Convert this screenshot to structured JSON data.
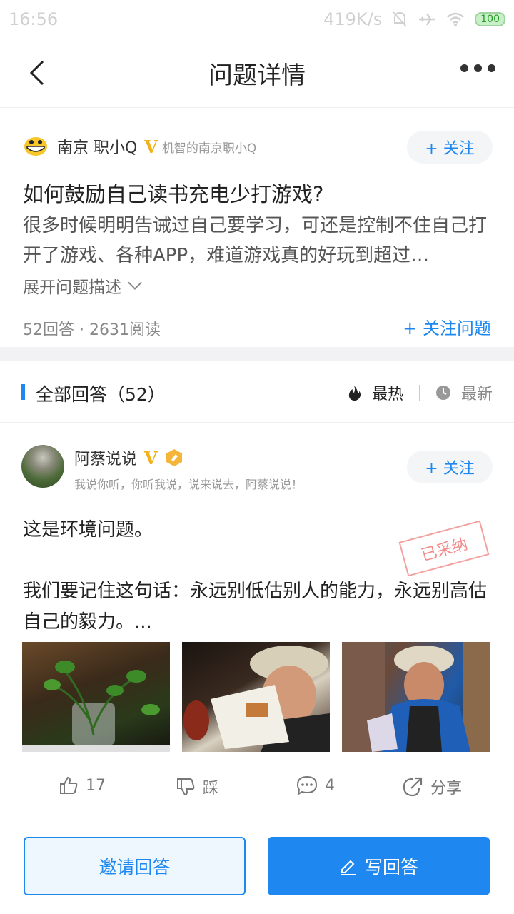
{
  "status_bar": {
    "time": "16:56",
    "network_speed": "419K/s",
    "battery": "100"
  },
  "nav": {
    "title": "问题详情"
  },
  "question": {
    "asker_name": "南京 职小Q",
    "asker_signature": "机智的南京职小Q",
    "follow_label": "+ 关注",
    "title": "如何鼓励自己读书充电少打游戏?",
    "description": "很多时候明明告诫过自己要学习，可还是控制不住自己打开了游戏、各种APP，难道游戏真的好玩到超过…",
    "expand_label": "展开问题描述",
    "stats": "52回答 · 2631阅读",
    "follow_question_label": "+ 关注问题"
  },
  "answers_header": {
    "label": "全部回答（52）",
    "sort_hot": "最热",
    "sort_new": "最新"
  },
  "answer": {
    "author_name": "阿蔡说说",
    "author_signature": "我说你听，你听我说，说来说去，阿蔡说说！",
    "follow_label": "+ 关注",
    "body_line1": "这是环境问题。",
    "body_line2": "我们要记住这句话：永远别低估别人的能力，永远别高估自己的毅力。...",
    "adopted_stamp": "已采纳",
    "like_count": "17",
    "dislike_label": "踩",
    "comment_count": "4",
    "share_label": "分享"
  },
  "bottom": {
    "invite_label": "邀请回答",
    "write_label": "写回答"
  },
  "colors": {
    "accent": "#1e88f0",
    "verified": "#f1b21b",
    "stamp": "#f06e6e"
  }
}
